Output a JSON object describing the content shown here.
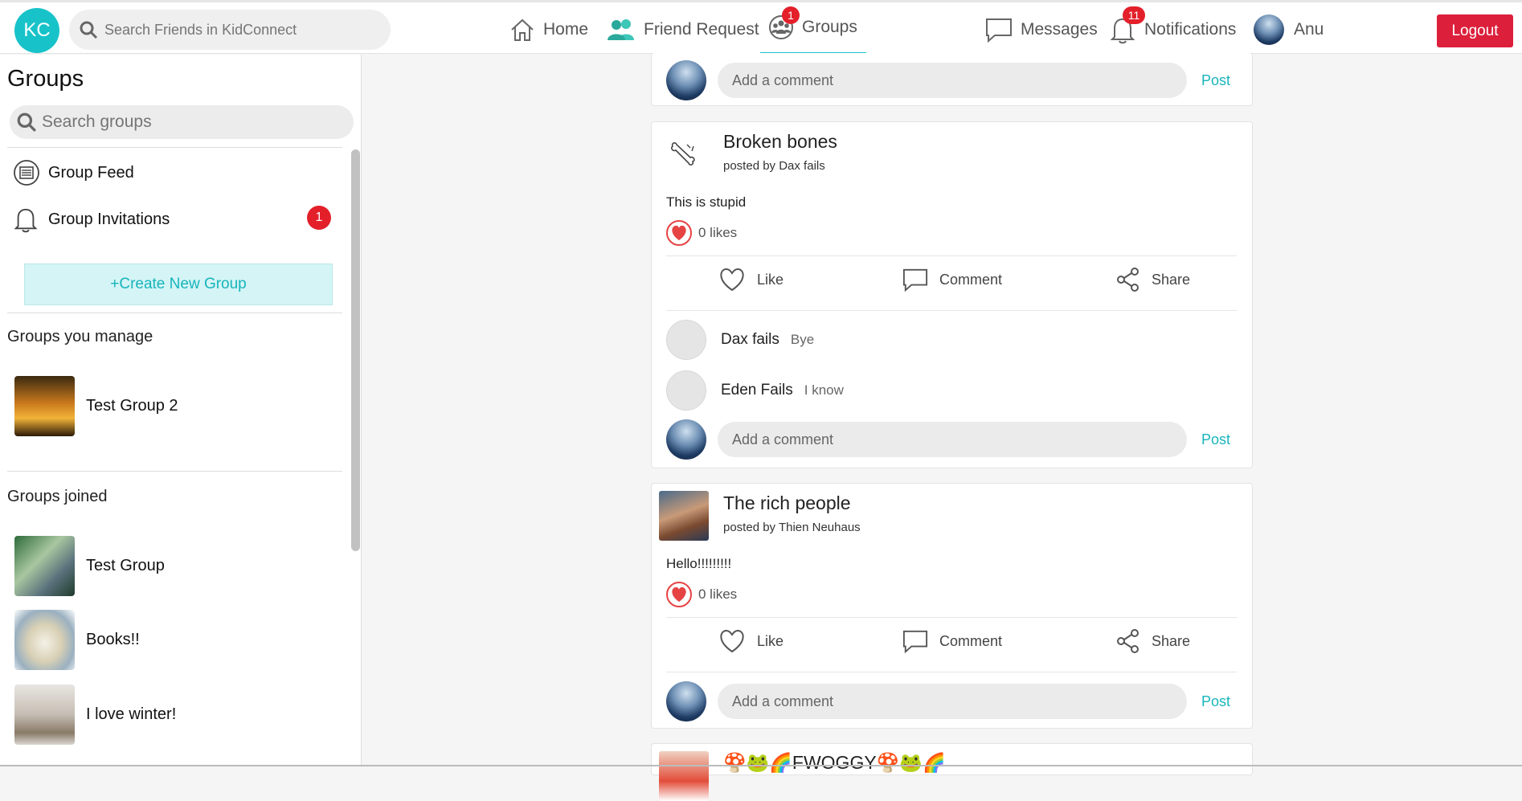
{
  "header": {
    "logo": "KC",
    "search_placeholder": "Search Friends in KidConnect",
    "nav": {
      "home": "Home",
      "friend_request": "Friend Request",
      "groups": "Groups",
      "groups_badge": "1",
      "messages": "Messages",
      "notifications": "Notifications",
      "notifications_badge": "11",
      "user": "Anu"
    },
    "logout": "Logout"
  },
  "sidebar": {
    "title": "Groups",
    "search_placeholder": "Search groups",
    "group_feed": "Group Feed",
    "group_invitations": "Group Invitations",
    "invitations_badge": "1",
    "create_group": "+Create New Group",
    "manage_title": "Groups you manage",
    "managed": [
      {
        "name": "Test Group 2"
      }
    ],
    "joined_title": "Groups joined",
    "joined": [
      {
        "name": "Test Group"
      },
      {
        "name": "Books!!"
      },
      {
        "name": "I love winter!"
      }
    ]
  },
  "feed": {
    "add_comment_placeholder": "Add a comment",
    "post_label": "Post",
    "like_label": "Like",
    "comment_label": "Comment",
    "share_label": "Share",
    "posts": [
      {
        "title": "Broken bones",
        "author": "posted by Dax fails",
        "body": "This is stupid",
        "likes": "0 likes",
        "comments": [
          {
            "name": "Dax fails",
            "text": "Bye"
          },
          {
            "name": "Eden Fails",
            "text": "I know"
          }
        ]
      },
      {
        "title": "The rich people",
        "author": "posted by Thien Neuhaus",
        "body": "Hello!!!!!!!!!",
        "likes": "0 likes"
      },
      {
        "title": "🍄🐸🌈FWOGGY🍄🐸🌈"
      }
    ]
  }
}
